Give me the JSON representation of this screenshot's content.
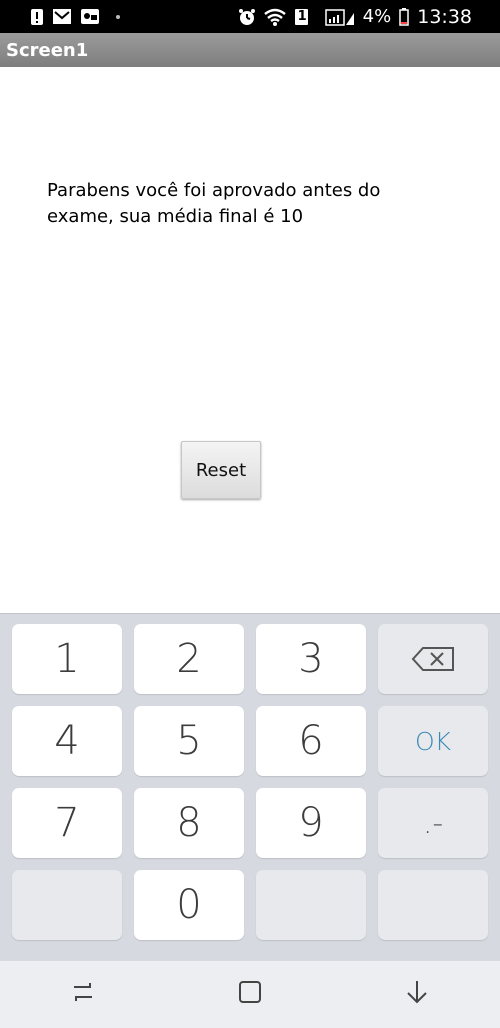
{
  "status_bar": {
    "icons_left": [
      "alert-icon",
      "mail-icon",
      "weather-icon"
    ],
    "icons_right": [
      "alarm-icon",
      "wifi-icon",
      "sim-icon",
      "signal-icon",
      "battery-icon"
    ],
    "sim_label": "1",
    "battery_percent": "4%",
    "time": "13:38"
  },
  "app_bar": {
    "title": "Screen1"
  },
  "content": {
    "result_text": "Parabens você foi aprovado antes do exame, sua média final é 10",
    "reset_label": "Reset"
  },
  "keyboard": {
    "keys": [
      "1",
      "2",
      "3",
      "4",
      "5",
      "6",
      "7",
      "8",
      "9",
      "0"
    ],
    "ok_label": "OK",
    "dot_label": ".-",
    "backspace_icon": "backspace-icon"
  },
  "nav_bar": {
    "icons": [
      "recent-apps-icon",
      "home-icon",
      "back-icon"
    ]
  },
  "colors": {
    "status_bar_bg": "#000000",
    "app_bar_bg": "#8a8a8a",
    "keyboard_bg": "#d6d9df",
    "ok_accent": "#3a8ab8",
    "nav_bar_bg": "#eceef1"
  }
}
